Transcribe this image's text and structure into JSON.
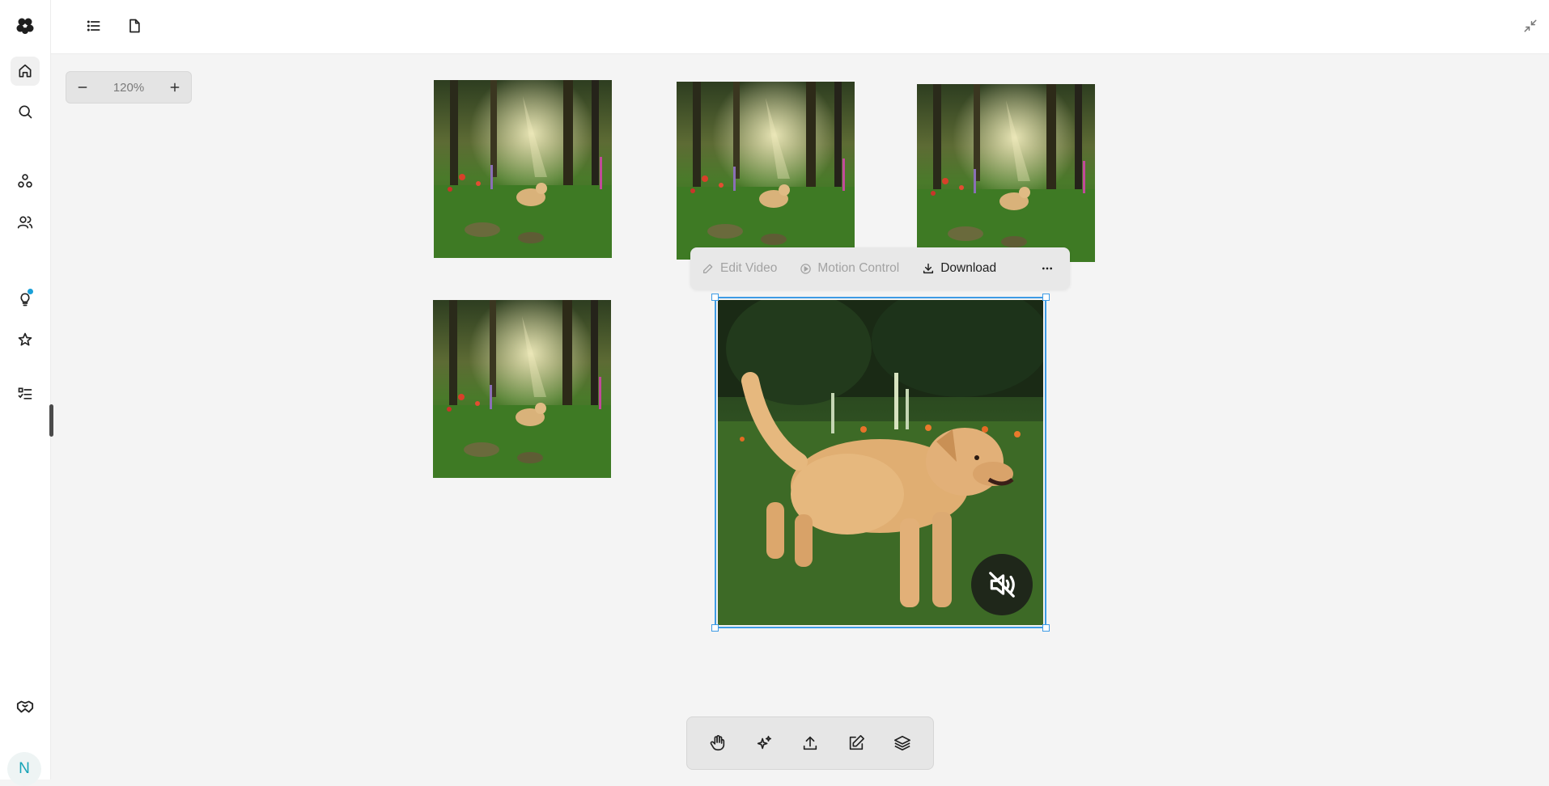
{
  "rail": {
    "items": [
      {
        "name": "logo",
        "icon": "flower-logo-icon"
      },
      {
        "name": "home",
        "icon": "home-icon",
        "active": true
      },
      {
        "name": "search",
        "icon": "search-icon"
      },
      {
        "name": "models",
        "icon": "nodes-icon"
      },
      {
        "name": "community",
        "icon": "users-icon"
      },
      {
        "name": "ideas",
        "icon": "lightbulb-icon",
        "has_notification": true
      },
      {
        "name": "favorites",
        "icon": "star-icon"
      },
      {
        "name": "tasks",
        "icon": "checklist-icon"
      },
      {
        "name": "partners",
        "icon": "handshake-icon"
      }
    ],
    "avatar_initial": "N"
  },
  "topbar": {
    "icons": [
      "list-icon",
      "document-icon",
      "collapse-icon"
    ]
  },
  "zoom": {
    "level": "120%",
    "decrease_icon": "minus-icon",
    "increase_icon": "plus-icon"
  },
  "canvas": {
    "thumbnails": [
      {
        "name": "forest-dog-image-1"
      },
      {
        "name": "forest-dog-image-2"
      },
      {
        "name": "forest-dog-image-3"
      },
      {
        "name": "forest-dog-image-4"
      }
    ],
    "selected_video": {
      "name": "running-dog-video",
      "muted": true,
      "mute_icon": "speaker-muted-icon"
    }
  },
  "context_menu": {
    "edit_video": "Edit Video",
    "motion_control": "Motion Control",
    "download": "Download",
    "more_icon": "more-horizontal-icon"
  },
  "toolbar": {
    "tools": [
      "hand-icon",
      "sparkles-icon",
      "upload-icon",
      "edit-icon",
      "layers-icon"
    ]
  },
  "colors": {
    "accent": "#3d9be5",
    "notification": "#1aa0d8",
    "avatar_text": "#16a3b7"
  }
}
